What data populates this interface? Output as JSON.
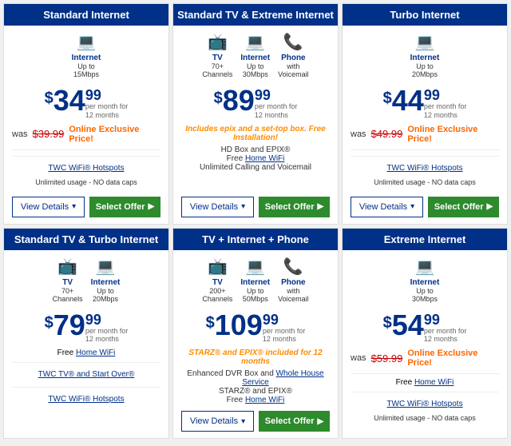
{
  "cards": [
    {
      "id": "standard-internet",
      "header": "Standard Internet",
      "services": [
        {
          "icon": "💻",
          "label": "Internet",
          "sublabel": "Up to\n15Mbps"
        }
      ],
      "price": {
        "dollar": "$",
        "whole": "34",
        "cents": "99",
        "sub": "per month for\n12 months"
      },
      "was": {
        "label": "was",
        "price": "$39.99"
      },
      "exclusive": "Online Exclusive Price!",
      "wifi": {
        "link": "TWC WiFi® Hotspots",
        "sub": "Unlimited usage - NO data caps"
      },
      "features": [],
      "buttons": {
        "details": "View Details",
        "select": "Select Offer"
      }
    },
    {
      "id": "standard-tv-extreme-internet",
      "header": "Standard TV & Extreme Internet",
      "services": [
        {
          "icon": "📺",
          "label": "TV",
          "sublabel": "70+\nChannels"
        },
        {
          "icon": "💻",
          "label": "Internet",
          "sublabel": "Up to\n30Mbps"
        },
        {
          "icon": "📞",
          "label": "Phone",
          "sublabel": "with\nVoicemail"
        }
      ],
      "price": {
        "dollar": "$",
        "whole": "89",
        "cents": "99",
        "sub": "per month for\n12 months"
      },
      "was": null,
      "exclusive": null,
      "promo": "Includes epix and a set-top box. Free Installation!",
      "features": [
        {
          "text": "HD Box and EPIX®"
        },
        {
          "text": "Free ",
          "link": "Home WiFi",
          "after": ""
        },
        {
          "text": "Unlimited Calling and Voicemail"
        }
      ],
      "wifi": null,
      "buttons": {
        "details": "View Details",
        "select": "Select Offer"
      }
    },
    {
      "id": "turbo-internet",
      "header": "Turbo Internet",
      "services": [
        {
          "icon": "💻",
          "label": "Internet",
          "sublabel": "Up to\n20Mbps"
        }
      ],
      "price": {
        "dollar": "$",
        "whole": "44",
        "cents": "99",
        "sub": "per month for\n12 months"
      },
      "was": {
        "label": "was",
        "price": "$49.99"
      },
      "exclusive": "Online Exclusive Price!",
      "wifi": {
        "link": "TWC WiFi® Hotspots",
        "sub": "Unlimited usage - NO data caps"
      },
      "features": [],
      "buttons": {
        "details": "View Details",
        "select": "Select Offer"
      }
    },
    {
      "id": "standard-tv-turbo-internet",
      "header": "Standard TV & Turbo Internet",
      "services": [
        {
          "icon": "📺",
          "label": "TV",
          "sublabel": "70+\nChannels"
        },
        {
          "icon": "💻",
          "label": "Internet",
          "sublabel": "Up to\n20Mbps"
        }
      ],
      "price": {
        "dollar": "$",
        "whole": "79",
        "cents": "99",
        "sub": "per month for\n12 months"
      },
      "was": null,
      "exclusive": null,
      "promo": null,
      "features": [],
      "wifi": null,
      "freeHomeWifi": "Free Home WiFi",
      "extraLinks": [
        "TWC TV® and Start Over®",
        "TWC WiFi® Hotspots"
      ],
      "buttons": {
        "details": null,
        "select": null
      }
    },
    {
      "id": "tv-internet-phone",
      "header": "TV + Internet + Phone",
      "services": [
        {
          "icon": "📺",
          "label": "TV",
          "sublabel": "200+\nChannels"
        },
        {
          "icon": "💻",
          "label": "Internet",
          "sublabel": "Up to\n50Mbps"
        },
        {
          "icon": "📞",
          "label": "Phone",
          "sublabel": "with\nVoicemail"
        }
      ],
      "price": {
        "dollar": "$",
        "whole": "109",
        "cents": "99",
        "sub": "per month for\n12 months"
      },
      "was": null,
      "exclusive": null,
      "promo": "STARZ® and EPIX® included for 12 months",
      "features": [
        {
          "text": "Enhanced DVR Box and ",
          "link": "Whole House Service",
          "after": ""
        },
        {
          "text": "STARZ® and EPIX®"
        },
        {
          "text": "Free ",
          "link": "Home WiFi",
          "after": ""
        }
      ],
      "wifi": null,
      "buttons": {
        "details": "View Details",
        "select": "Select Offer"
      }
    },
    {
      "id": "extreme-internet",
      "header": "Extreme Internet",
      "services": [
        {
          "icon": "💻",
          "label": "Internet",
          "sublabel": "Up to\n30Mbps"
        }
      ],
      "price": {
        "dollar": "$",
        "whole": "54",
        "cents": "99",
        "sub": "per month for\n12 months"
      },
      "was": {
        "label": "was",
        "price": "$59.99"
      },
      "exclusive": "Online Exclusive Price!",
      "wifi": {
        "link": "TWC WiFi® Hotspots",
        "sub": "Unlimited usage - NO data caps"
      },
      "freeHomeWifi": "Free Home WiFi",
      "features": [],
      "buttons": {
        "details": null,
        "select": null
      }
    }
  ]
}
